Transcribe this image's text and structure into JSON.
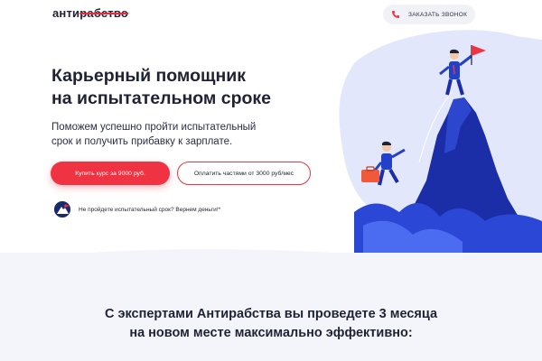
{
  "header": {
    "logo_plain": "анти",
    "logo_strike": "рабство",
    "call_label": "ЗАКАЗАТЬ ЗВОНОК",
    "phone_icon": "phone-icon"
  },
  "hero": {
    "title_line1": "Карьерный помощник",
    "title_line2": "на испытательном сроке",
    "subtitle_line1": "Поможем успешно пройти испытательный",
    "subtitle_line2": "срок и получить прибавку к зарплате.",
    "buy_label": "Купить курс за 9000 руб.",
    "installment_label": "Оплатить частями от 3000 руб/мес",
    "guarantee_text": "Не пройдете испытательный срок?  Вернем деньги!*"
  },
  "section": {
    "heading_line1": "С экспертами Антирабства вы проведете 3 месяца",
    "heading_line2": "на новом месте максимально эффективно:"
  },
  "colors": {
    "accent": "#ef3342",
    "dark": "#1f2233",
    "mountain": "#1b2ea8",
    "blob": "#e3e7fb"
  }
}
